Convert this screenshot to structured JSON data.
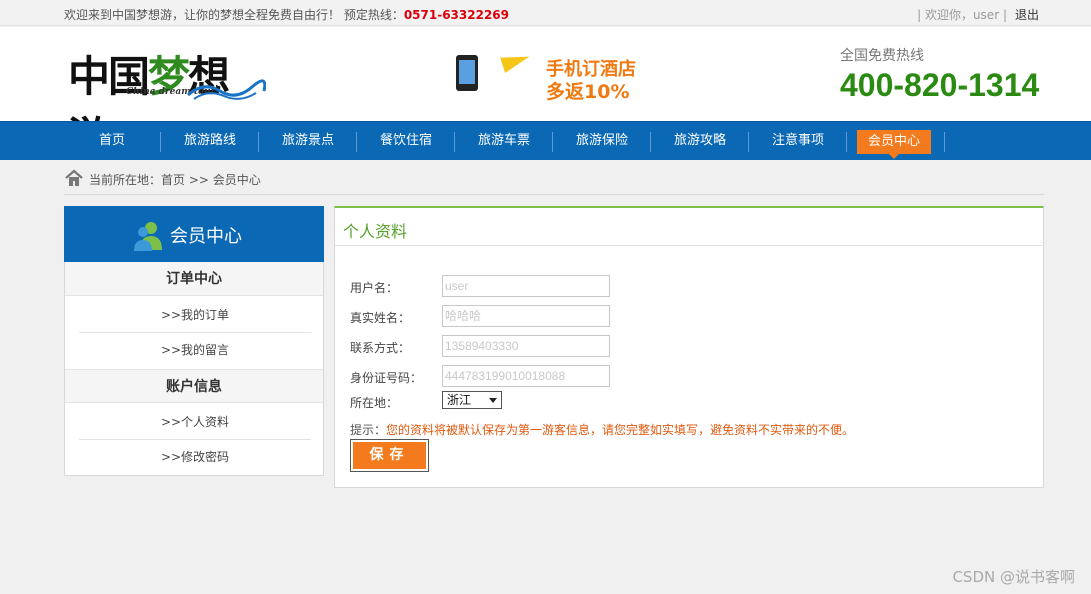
{
  "topbar": {
    "welcome": "欢迎来到中国梦想游，让你的梦想全程免费自由行！ 预定热线：",
    "phone": "0571-63322269",
    "greeting": "| 欢迎你，user |",
    "logout": "退出"
  },
  "logo": {
    "cn_prefix": "中国",
    "cn_green": "梦",
    "cn_suffix": "想游",
    "en": "China dream tour"
  },
  "promo": {
    "line1": "手机订酒店",
    "line2": "多返10%"
  },
  "hotline": {
    "label": "全国免费热线",
    "number": "400-820-1314"
  },
  "nav": {
    "items": [
      "首页",
      "旅游路线",
      "旅游景点",
      "餐饮住宿",
      "旅游车票",
      "旅游保险",
      "旅游攻略",
      "注意事项",
      "会员中心"
    ],
    "active": "会员中心"
  },
  "breadcrumb": {
    "text": "当前所在地：首页 >> 会员中心"
  },
  "sidebar": {
    "title": "会员中心",
    "sections": [
      {
        "title": "订单中心",
        "items": [
          ">>我的订单",
          ">>我的留言"
        ]
      },
      {
        "title": "账户信息",
        "items": [
          ">>个人资料",
          ">>修改密码"
        ]
      }
    ]
  },
  "profile": {
    "title": "个人资料",
    "fields": [
      {
        "label": "用户名：",
        "value": "user"
      },
      {
        "label": "真实姓名：",
        "value": "哈哈哈"
      },
      {
        "label": "联系方式：",
        "value": "13589403330"
      },
      {
        "label": "身份证号码：",
        "value": "444783199010018088"
      }
    ],
    "location_label": "所在地：",
    "location_value": "浙江",
    "tip_key": "提示：",
    "tip_text": "您的资料将被默认保存为第一游客信息，请您完整如实填写，避免资料不实带来的不便。",
    "save_label": "保存"
  },
  "watermark": "CSDN @说书客啊",
  "colors": {
    "nav_blue": "#0a68b4",
    "accent_orange": "#f37b1d",
    "green": "#58a12e",
    "hotline_green": "#2b8a12"
  }
}
